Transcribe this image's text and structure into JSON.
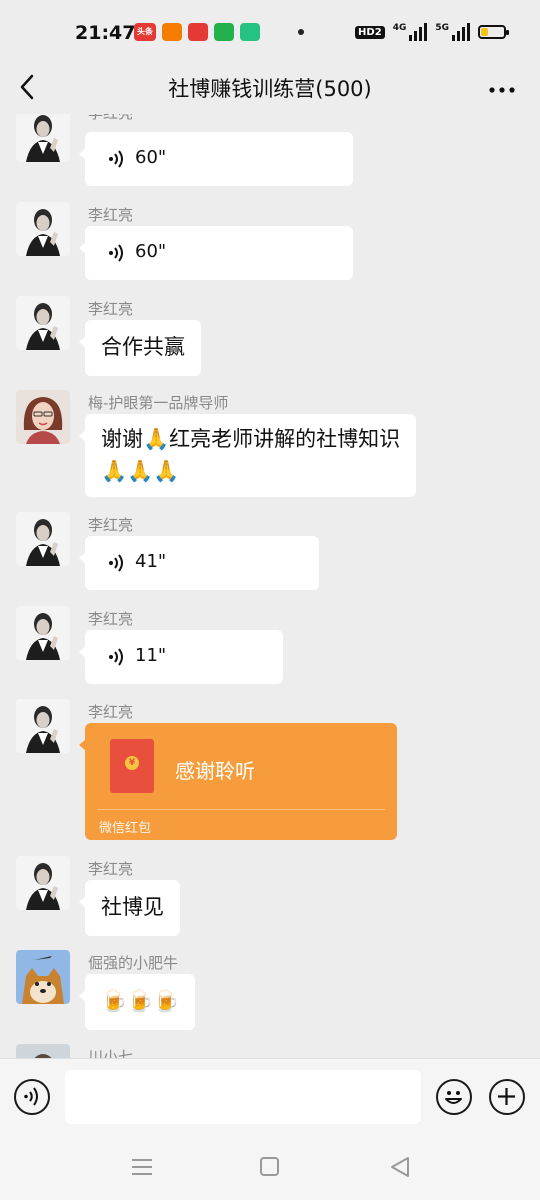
{
  "status_bar": {
    "time": "21:47",
    "apps": [
      {
        "label": "头条",
        "color": "#e53935"
      },
      {
        "label": "",
        "color": "#f57c00"
      },
      {
        "label": "",
        "color": "#e53935"
      },
      {
        "label": "",
        "color": "#22b14c"
      },
      {
        "label": "",
        "color": "#26c281"
      }
    ],
    "hd_badge": "HD2",
    "net1": "4G",
    "net2": "5G",
    "battery_level": 0.3,
    "battery_color": "#f0c419"
  },
  "header": {
    "title": "社博赚钱训练营(500)",
    "back_icon": "chevron-left-icon",
    "more_icon": "more-dots-icon"
  },
  "messages": [
    {
      "sender": "李红亮",
      "type": "voice",
      "duration": "60\""
    },
    {
      "sender": "李红亮",
      "type": "voice",
      "duration": "60\""
    },
    {
      "sender": "李红亮",
      "type": "text",
      "text": "合作共赢"
    },
    {
      "sender": "梅-护眼第一品牌导师",
      "type": "text",
      "text_line1": "谢谢🙏红亮老师讲解的社博知识",
      "text_line2": "🙏🙏🙏"
    },
    {
      "sender": "李红亮",
      "type": "voice",
      "duration": "41\""
    },
    {
      "sender": "李红亮",
      "type": "voice",
      "duration": "11\""
    },
    {
      "sender": "李红亮",
      "type": "red_packet",
      "title": "感谢聆听",
      "label": "微信红包",
      "coin": "¥"
    },
    {
      "sender": "李红亮",
      "type": "text",
      "text": "社博见"
    },
    {
      "sender": "倔强的小肥牛",
      "type": "text",
      "text": "🍺🍺🍺"
    },
    {
      "sender": "川小七",
      "type": "partial"
    }
  ],
  "input_bar": {
    "voice_icon": "voice-mode-icon",
    "emoji_icon": "emoji-icon",
    "plus_icon": "plus-icon",
    "placeholder": ""
  },
  "nav": {
    "menu_icon": "menu-icon",
    "home_icon": "home-square-icon",
    "back_icon": "back-triangle-icon"
  },
  "colors": {
    "background": "#ededed",
    "bubble": "#ffffff",
    "red_packet": "#f79c3c",
    "sender_name": "#8a8a8a"
  }
}
